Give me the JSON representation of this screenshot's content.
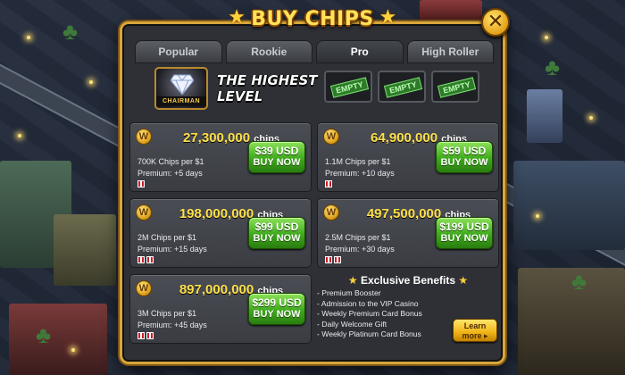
{
  "dialog": {
    "title": "BUY CHIPS",
    "close_label": "✕",
    "tabs": [
      {
        "label": "Popular"
      },
      {
        "label": "Rookie"
      },
      {
        "label": "Pro"
      },
      {
        "label": "High Roller"
      }
    ],
    "active_tab": "Pro"
  },
  "status": {
    "badge_label": "CHAIRMAN",
    "level_line1": "THE HIGHEST",
    "level_line2": "LEVEL",
    "slots": [
      "EMPTY",
      "EMPTY",
      "EMPTY"
    ]
  },
  "packages": [
    {
      "chips": "27,300,000",
      "unit": "chips",
      "rate": "700K Chips per $1",
      "premium": "Premium: +5 days",
      "gifts": 1,
      "price": "$39 USD",
      "buy": "BUY NOW"
    },
    {
      "chips": "64,900,000",
      "unit": "chips",
      "rate": "1.1M Chips per $1",
      "premium": "Premium: +10 days",
      "gifts": 1,
      "price": "$59 USD",
      "buy": "BUY NOW"
    },
    {
      "chips": "198,000,000",
      "unit": "chips",
      "rate": "2M Chips per $1",
      "premium": "Premium: +15 days",
      "gifts": 2,
      "price": "$99 USD",
      "buy": "BUY NOW"
    },
    {
      "chips": "497,500,000",
      "unit": "chips",
      "rate": "2.5M Chips per $1",
      "premium": "Premium: +30 days",
      "gifts": 2,
      "price": "$199 USD",
      "buy": "BUY NOW"
    },
    {
      "chips": "897,000,000",
      "unit": "chips",
      "rate": "3M Chips per $1",
      "premium": "Premium: +45 days",
      "gifts": 2,
      "price": "$299 USD",
      "buy": "BUY NOW"
    }
  ],
  "benefits": {
    "title": "Exclusive Benefits",
    "items": [
      "- Premium Booster",
      "- Admission to the VIP Casino",
      "- Weekly Premium Card Bonus",
      "- Daily Welcome Gift",
      "- Weekly Platinum Card Bonus"
    ],
    "learn_line1": "Learn",
    "learn_line2": "more ▸"
  },
  "coin_symbol": "W",
  "colors": {
    "gold": "#ffd23a",
    "green_button": "#3ea81c",
    "panel": "#2e3036"
  }
}
